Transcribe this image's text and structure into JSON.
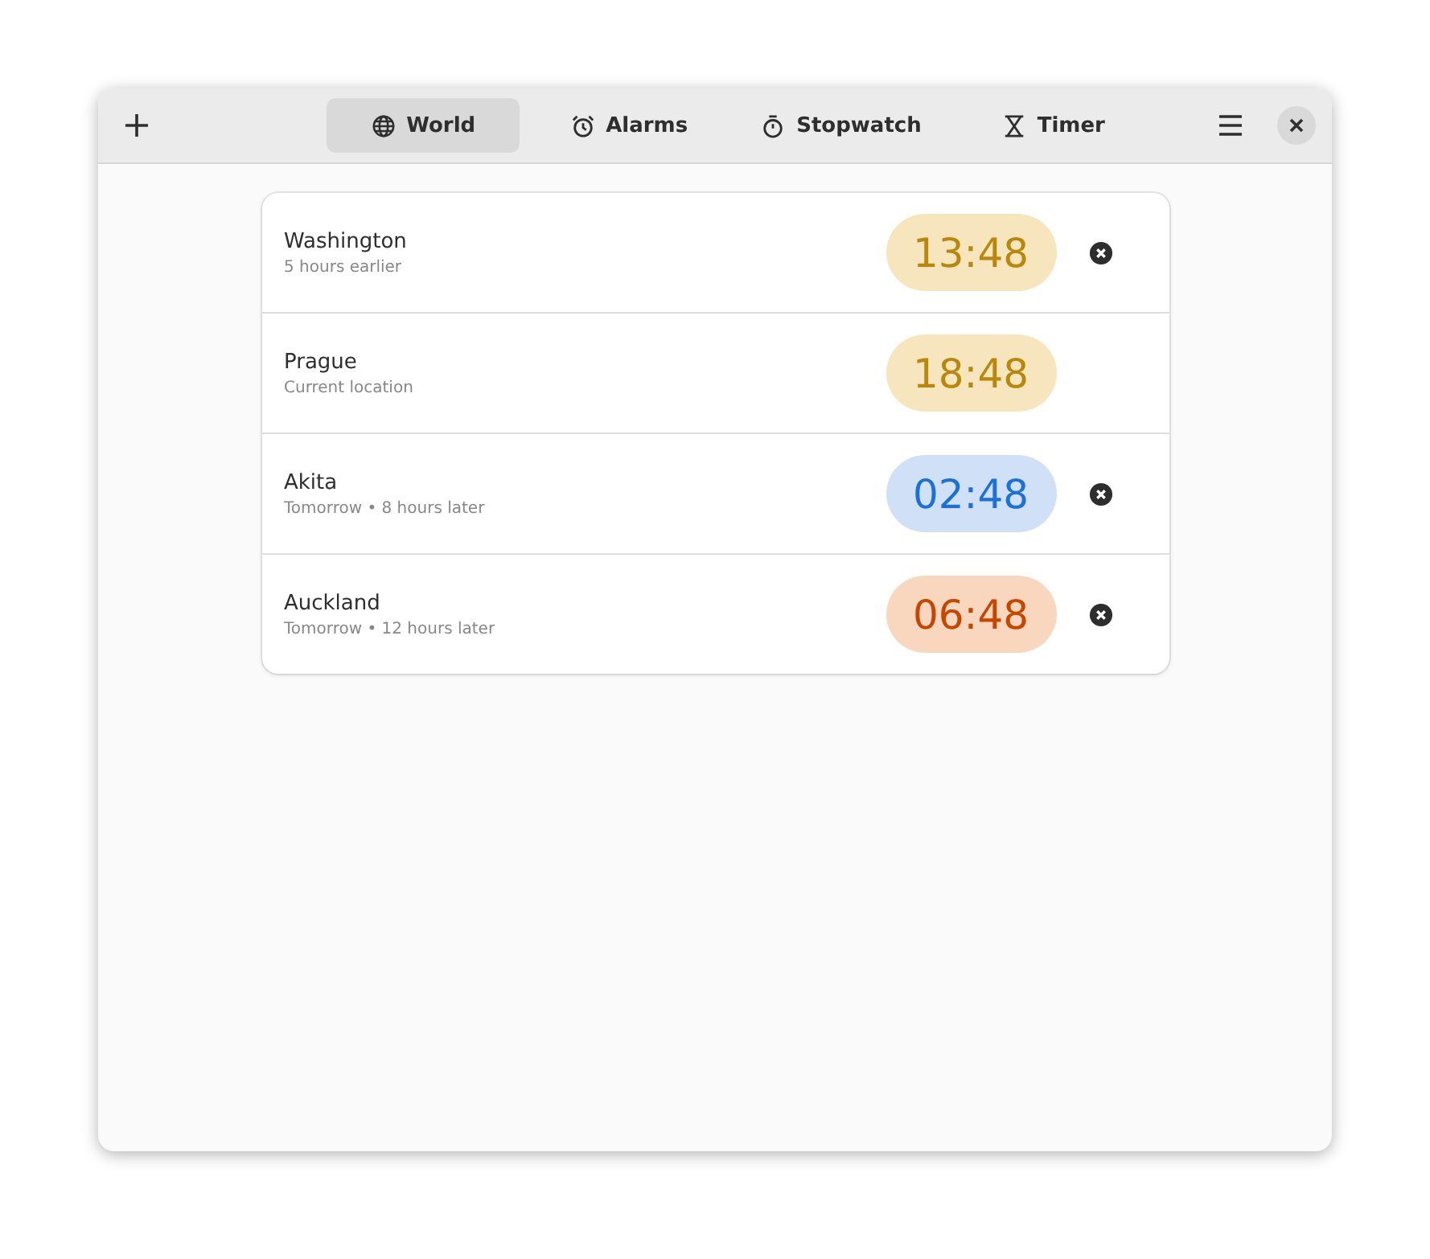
{
  "tabs": [
    {
      "kind": "globe",
      "label": "World",
      "selected": true
    },
    {
      "kind": "alarm",
      "label": "Alarms",
      "selected": false
    },
    {
      "kind": "stopwatch",
      "label": "Stopwatch",
      "selected": false
    },
    {
      "kind": "hourglass",
      "label": "Timer",
      "selected": false
    }
  ],
  "clocks": [
    {
      "city": "Washington",
      "offset": "5 hours earlier",
      "time": "13:48",
      "kind": "day",
      "removable": true
    },
    {
      "city": "Prague",
      "offset": "Current location",
      "time": "18:48",
      "kind": "day",
      "removable": false
    },
    {
      "city": "Akita",
      "offset": "Tomorrow • 8 hours later",
      "time": "02:48",
      "kind": "night",
      "removable": true
    },
    {
      "city": "Auckland",
      "offset": "Tomorrow • 12 hours later",
      "time": "06:48",
      "kind": "dawn",
      "removable": true
    }
  ]
}
